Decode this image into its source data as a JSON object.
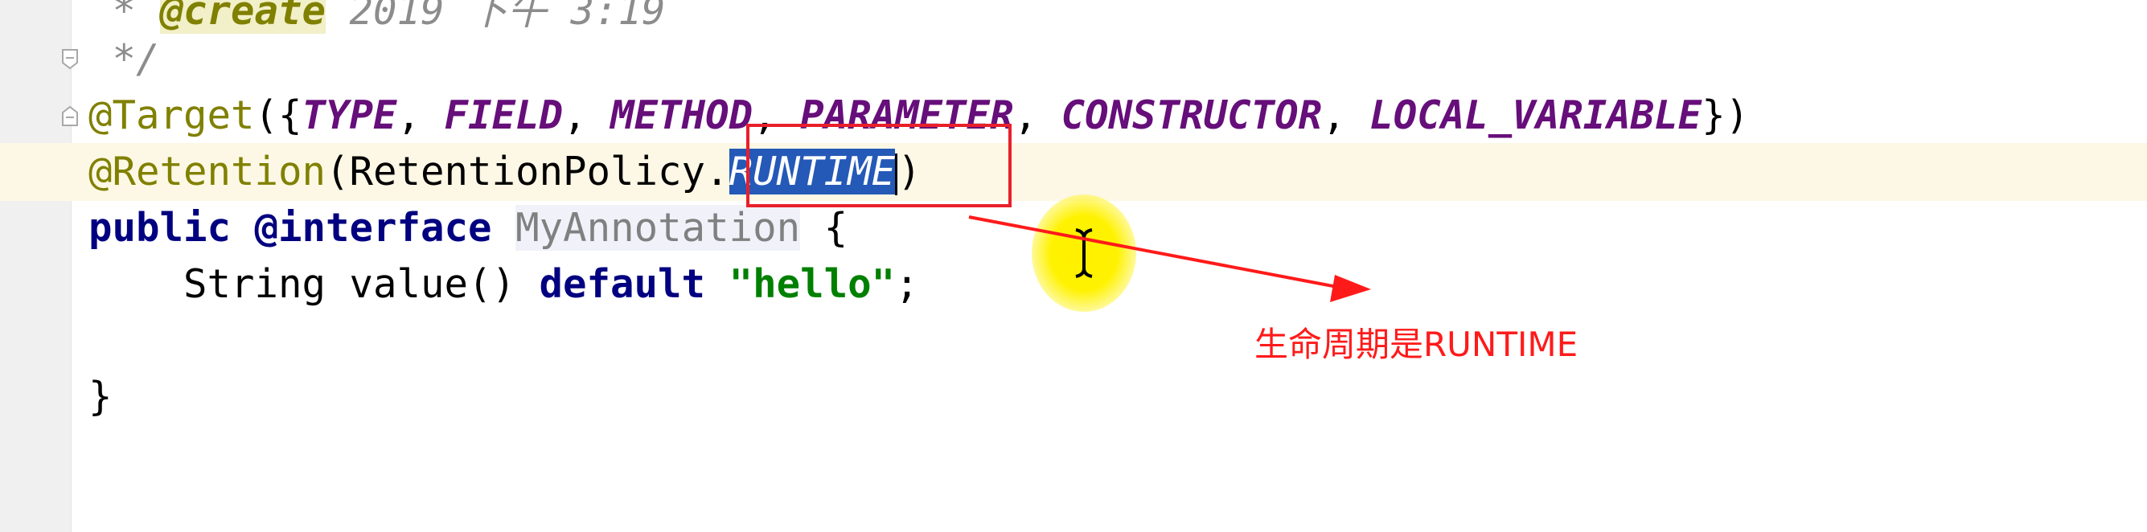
{
  "editor": {
    "lines": {
      "line1": {
        "prefix": " * ",
        "tag": "@create",
        "text": " 2019 下午 3:19"
      },
      "line2": {
        "text": " */"
      },
      "line3": {
        "annotation": "@Target",
        "open": "({",
        "sep": ", ",
        "close": "})",
        "constants": [
          "TYPE",
          "FIELD",
          "METHOD",
          "PARAMETER",
          "CONSTRUCTOR",
          "LOCAL_VARIABLE"
        ]
      },
      "line4": {
        "annotation": "@Retention",
        "open": "(",
        "class_ref": "RetentionPolicy",
        "dot": ".",
        "constant": "RUNTIME",
        "close": ")"
      },
      "line5": {
        "kw_public": "public",
        "kw_interface": "@interface",
        "name": "MyAnnotation",
        "brace": "{"
      },
      "line6": {
        "indent": "    ",
        "type": "String",
        "method": " value() ",
        "kw_default": "default",
        "string": "\"hello\"",
        "end": ";"
      },
      "line8": {
        "brace": "}"
      }
    }
  },
  "overlay": {
    "note": "生命周期是RUNTIME",
    "box_color": "#e8202a",
    "arrow_color": "#ff1a1a",
    "note_color": "#ff1a1a",
    "halo_color": "#fff200"
  },
  "colors": {
    "annotation": "#808000",
    "constant": "#660e7a",
    "keyword": "#000080",
    "string": "#008000",
    "comment": "#8c8c8c",
    "selection": "#2459b8",
    "current_line": "#fdf8e5"
  }
}
